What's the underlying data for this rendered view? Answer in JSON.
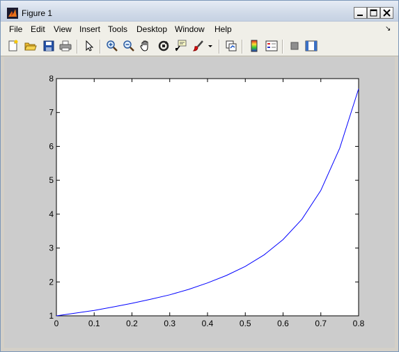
{
  "window": {
    "title": "Figure 1",
    "controls": {
      "minimize": "_",
      "maximize": "□",
      "close": "✕"
    }
  },
  "menubar": {
    "items": [
      "File",
      "Edit",
      "View",
      "Insert",
      "Tools",
      "Desktop",
      "Window",
      "Help"
    ],
    "overflow_glyph": "↘"
  },
  "toolbar": {
    "buttons": [
      "new-figure-icon",
      "open-file-icon",
      "save-icon",
      "print-icon",
      "edit-plot-arrow-icon",
      "zoom-in-icon",
      "zoom-out-icon",
      "pan-hand-icon",
      "rotate-3d-icon",
      "data-cursor-icon",
      "brush-icon",
      "brush-dropdown-icon",
      "link-plot-icon",
      "insert-colorbar-icon",
      "insert-legend-icon",
      "hide-plot-tools-icon",
      "show-plot-tools-icon"
    ]
  },
  "colors": {
    "line": "#0000ff",
    "figure_background": "#cccccc",
    "axes_background": "#ffffff"
  },
  "chart_data": {
    "type": "line",
    "title": "",
    "xlabel": "",
    "ylabel": "",
    "xlim": [
      0,
      0.8
    ],
    "ylim": [
      1,
      8
    ],
    "xticks": [
      "0",
      "0.1",
      "0.2",
      "0.3",
      "0.4",
      "0.5",
      "0.6",
      "0.7",
      "0.8"
    ],
    "yticks": [
      "1",
      "2",
      "3",
      "4",
      "5",
      "6",
      "7",
      "8"
    ],
    "grid": false,
    "legend": "none",
    "series": [
      {
        "color": "#0000ff",
        "x": [
          0,
          0.05,
          0.1,
          0.15,
          0.2,
          0.25,
          0.3,
          0.35,
          0.4,
          0.45,
          0.5,
          0.55,
          0.6,
          0.65,
          0.7,
          0.75,
          0.8
        ],
        "y": [
          1.0,
          1.08,
          1.16,
          1.26,
          1.37,
          1.49,
          1.62,
          1.78,
          1.97,
          2.19,
          2.46,
          2.8,
          3.25,
          3.85,
          4.7,
          5.95,
          7.7
        ]
      }
    ]
  }
}
